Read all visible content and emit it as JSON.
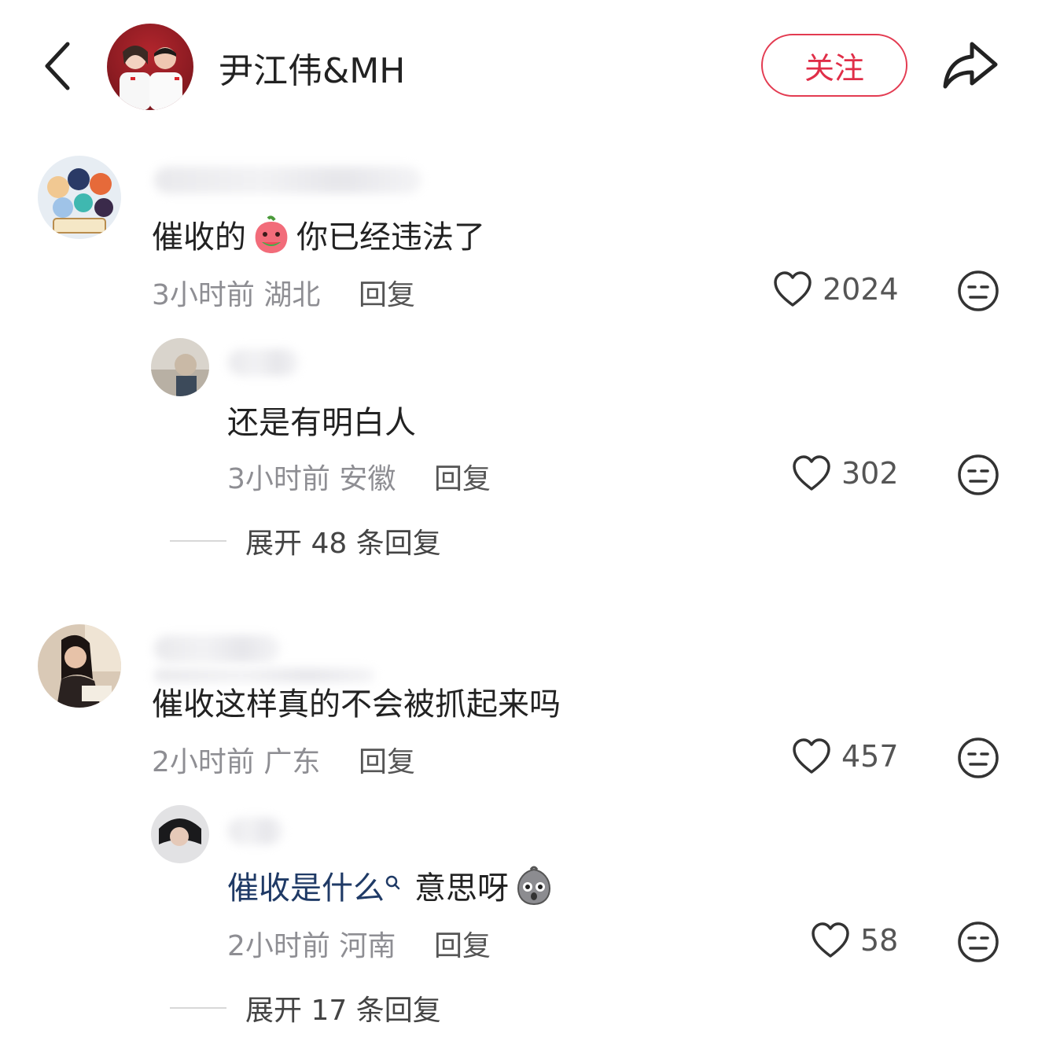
{
  "header": {
    "author_name": "尹江伟&MH",
    "follow_label": "关注"
  },
  "comments": [
    {
      "text_before": "催收的",
      "text_after": " 你已经违法了",
      "time": "3小时前",
      "location": "湖北",
      "reply_label": "回复",
      "likes": "2024",
      "reply": {
        "text": "还是有明白人",
        "time": "3小时前",
        "location": "安徽",
        "reply_label": "回复",
        "likes": "302"
      },
      "expand_label": "展开 48 条回复"
    },
    {
      "text": "催收这样真的不会被抓起来吗",
      "time": "2小时前",
      "location": "广东",
      "reply_label": "回复",
      "likes": "457",
      "reply": {
        "mention": "催收是什么",
        "text_after": "意思呀",
        "time": "2小时前",
        "location": "河南",
        "reply_label": "回复",
        "likes": "58"
      },
      "expand_label": "展开 17 条回复"
    }
  ],
  "colors": {
    "follow": "#e02e48",
    "meta": "#8e8e93",
    "mention": "#1f3a66"
  }
}
